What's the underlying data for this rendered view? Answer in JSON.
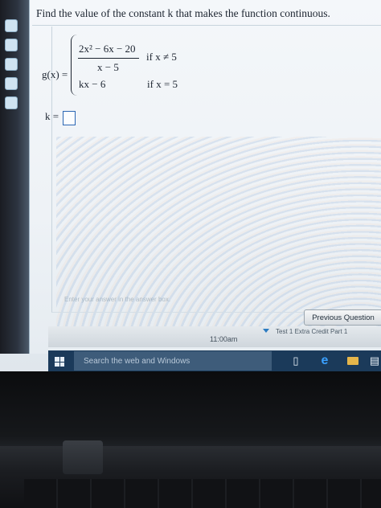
{
  "question": {
    "prompt": "Find the value of the constant k that makes the function continuous.",
    "function_name": "g(x) =",
    "piece1_numerator": "2x² − 6x − 20",
    "piece1_denominator": "x − 5",
    "piece1_condition": "if x ≠ 5",
    "piece2_expression": "kx − 6",
    "piece2_condition": "if x = 5",
    "answer_label": "k =",
    "answer_value": ""
  },
  "hint_text": "Enter your answer in the answer box.",
  "navigation": {
    "previous_button": "Previous Question"
  },
  "status": {
    "time": "11:00am",
    "blurred_item": "Test 1 Extra Credit Part 1"
  },
  "taskbar": {
    "search_placeholder": "Search the web and Windows",
    "icons": [
      "windows-start-icon",
      "task-view-icon",
      "edge-browser-icon",
      "file-explorer-icon",
      "store-icon"
    ]
  },
  "colors": {
    "answer_box_border": "#2a66b3",
    "taskbar": "#1b3a5a",
    "taskbar_search": "#3e5c7a"
  }
}
